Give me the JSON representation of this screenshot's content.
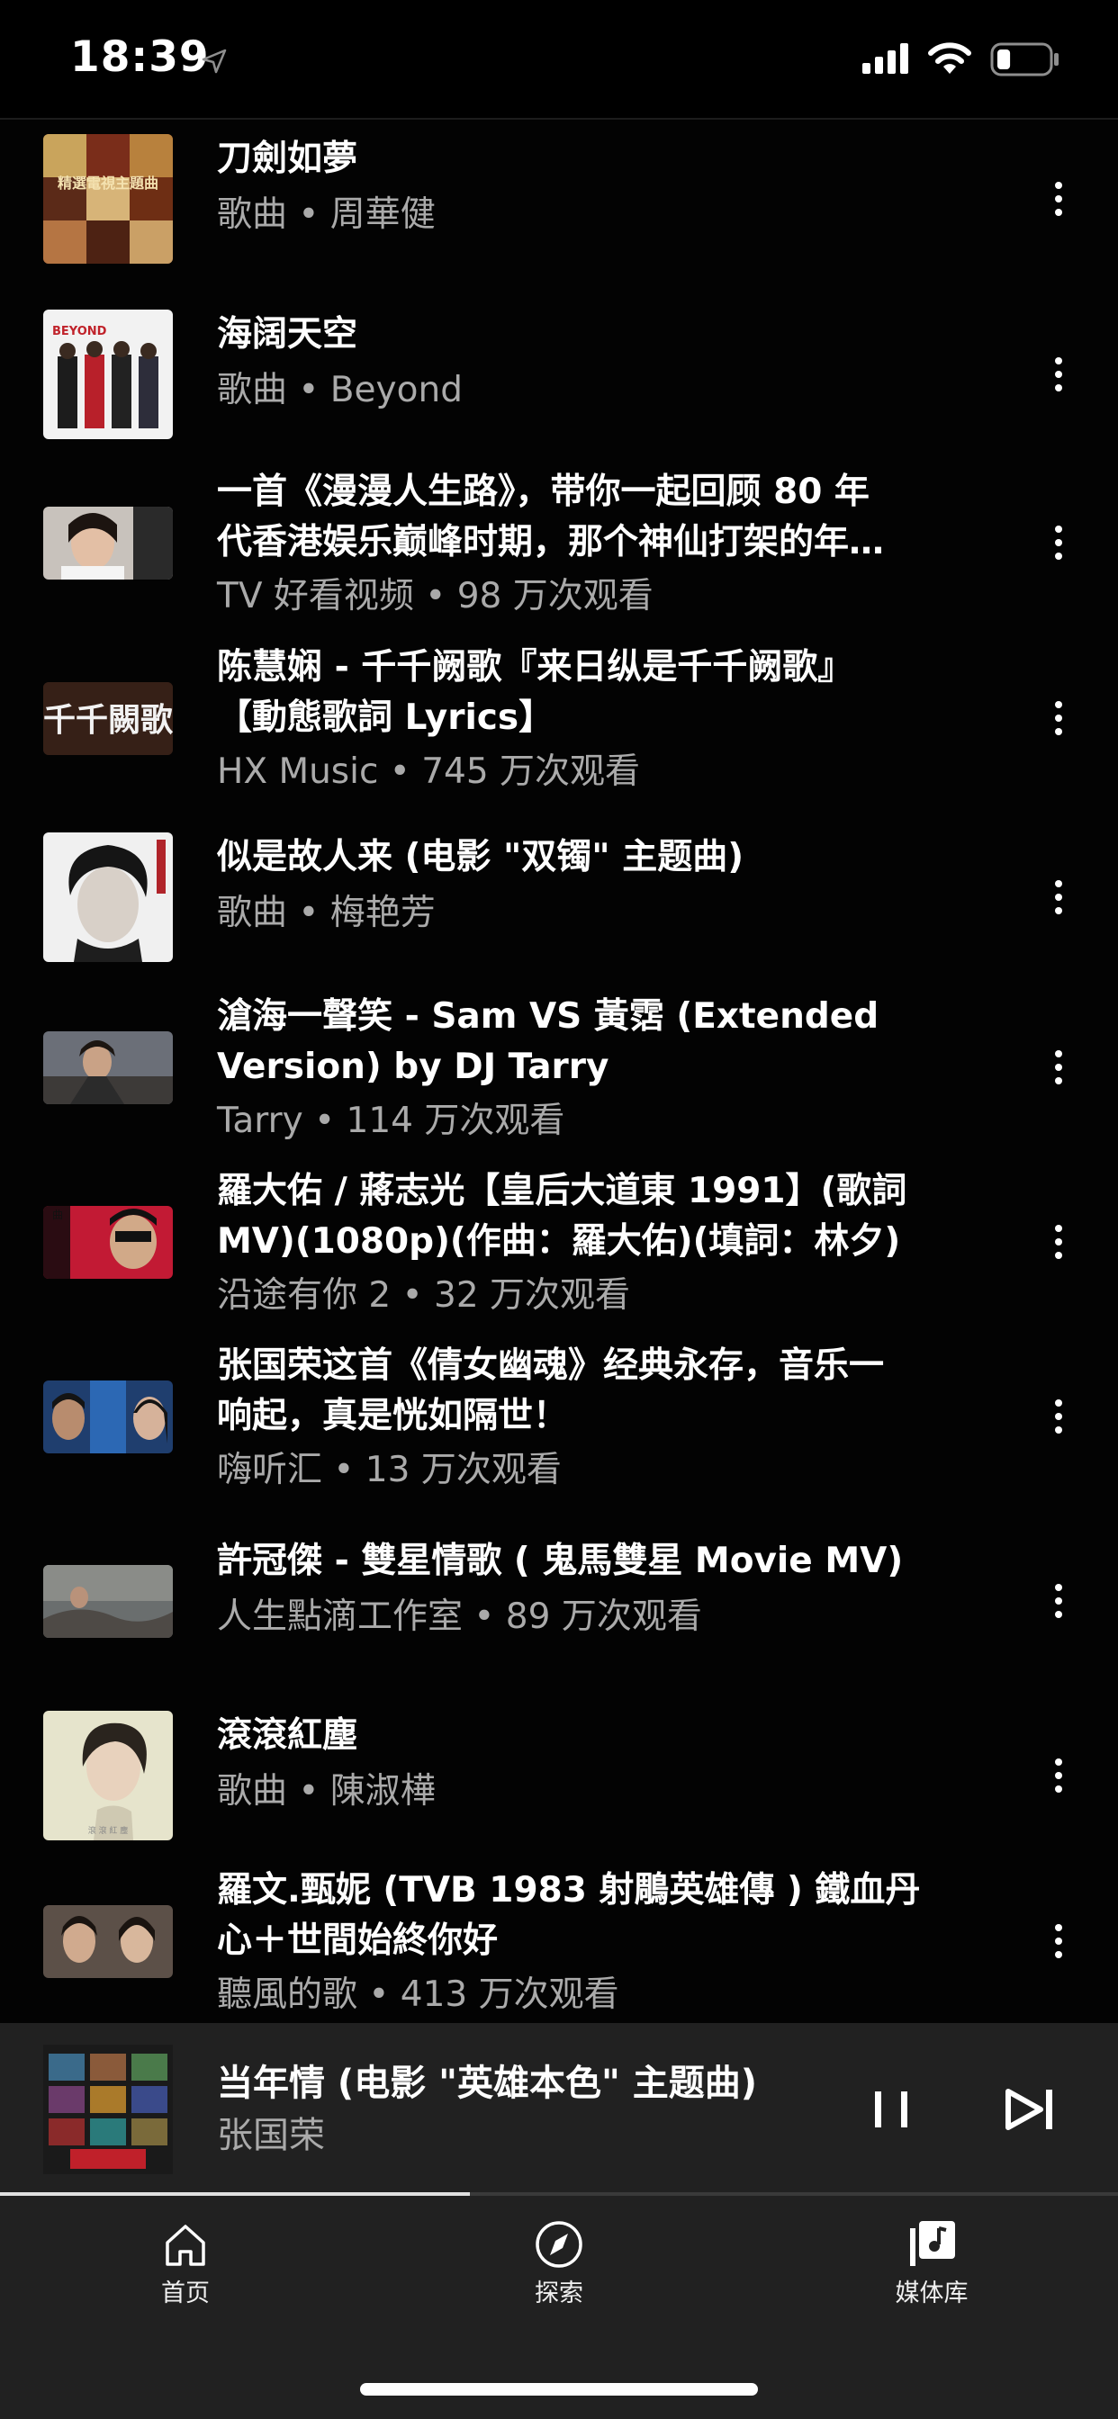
{
  "status_bar": {
    "time": "18:39",
    "icons": [
      "location-arrow-icon",
      "cellular-signal-icon",
      "wifi-icon",
      "battery-icon"
    ],
    "battery_level": 0.15
  },
  "list": {
    "items": [
      {
        "title_lines": [
          "刀劍如夢"
        ],
        "subtitle": "歌曲 • 周華健",
        "thumb": "album-art",
        "thumb_text": "精選電視主題曲"
      },
      {
        "title_lines": [
          "海阔天空"
        ],
        "subtitle": "歌曲 • Beyond",
        "thumb": "album-art",
        "thumb_text": "BEYOND"
      },
      {
        "title_lines": [
          "一首《漫漫人生路》，带你一起回顾 80 年",
          "代香港娱乐巅峰时期，那个神仙打架的年…"
        ],
        "subtitle": "TV 好看视频 • 98 万次观看",
        "thumb": "video"
      },
      {
        "title_lines": [
          "陈慧娴 - 千千阙歌『来日纵是千千阙歌』",
          "【動態歌詞 Lyrics】"
        ],
        "subtitle": "HX Music • 745 万次观看",
        "thumb": "video",
        "thumb_text": "千千闕歌"
      },
      {
        "title_lines": [
          "似是故人来 (电影 \"双镯\" 主题曲)"
        ],
        "subtitle": "歌曲 • 梅艳芳",
        "thumb": "album-art"
      },
      {
        "title_lines": [
          "滄海一聲笑 - Sam VS 黃霑 (Extended",
          "Version) by DJ Tarry"
        ],
        "subtitle": "Tarry • 114 万次观看",
        "thumb": "video"
      },
      {
        "title_lines": [
          "羅大佑 / 蔣志光【皇后大道東 1991】(歌詞",
          "MV)(1080p)(作曲：羅大佑)(填詞：林夕)"
        ],
        "subtitle": "沿途有你 2 • 32 万次观看",
        "thumb": "video"
      },
      {
        "title_lines": [
          "张国荣这首《倩女幽魂》经典永存，音乐一",
          "响起，真是恍如隔世！"
        ],
        "subtitle": "嗨听汇 • 13 万次观看",
        "thumb": "video"
      },
      {
        "title_lines": [
          "許冠傑 - 雙星情歌 ( 鬼馬雙星 Movie MV)"
        ],
        "subtitle": "人生點滴工作室 • 89 万次观看",
        "thumb": "video"
      },
      {
        "title_lines": [
          "滾滾紅塵"
        ],
        "subtitle": "歌曲 • 陳淑樺",
        "thumb": "album-art"
      },
      {
        "title_lines": [
          "羅文.甄妮 (TVB 1983 射鵰英雄傳 ) 鐵血丹",
          "心＋世間始終你好"
        ],
        "subtitle": "聽風的歌 • 413 万次观看",
        "thumb": "video"
      }
    ]
  },
  "mini_player": {
    "title": "当年情 (电影 \"英雄本色\" 主题曲)",
    "artist": "张国荣",
    "pause_icon": "pause-icon",
    "next_icon": "skip-next-icon",
    "progress": 0.42
  },
  "bottom_nav": {
    "items": [
      {
        "label": "首页",
        "icon": "home-icon"
      },
      {
        "label": "探索",
        "icon": "compass-icon"
      },
      {
        "label": "媒体库",
        "icon": "library-music-icon"
      }
    ]
  },
  "colors": {
    "background": "#030303",
    "secondary_text": "#aaaaaa",
    "panel": "#212121"
  }
}
